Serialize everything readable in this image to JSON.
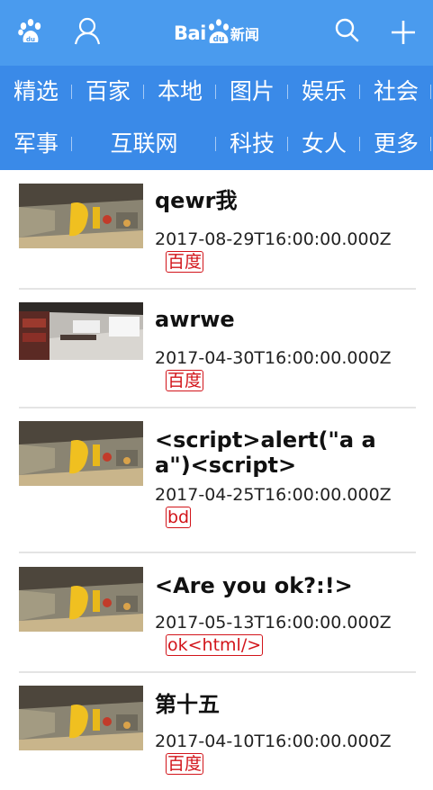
{
  "header": {
    "logo_text": "Bai",
    "logo_text_du": "du",
    "logo_suffix": "新闻",
    "icons": [
      "paw-icon",
      "user-icon",
      "search-icon",
      "plus-icon"
    ]
  },
  "nav": {
    "row1": [
      "精选",
      "百家",
      "本地",
      "图片",
      "娱乐",
      "社会"
    ],
    "row2": [
      "军事",
      "互联网",
      "科技",
      "女人",
      "更多"
    ]
  },
  "news": [
    {
      "title": "qewr我",
      "date": "2017-08-29T16:00:00.000Z",
      "source": "百度",
      "thumb": "office-yellow"
    },
    {
      "title": "awrwe",
      "date": "2017-04-30T16:00:00.000Z",
      "source": "百度",
      "thumb": "office-red"
    },
    {
      "title": "<script>alert(\"a a a\")<script>",
      "date": "2017-04-25T16:00:00.000Z",
      "source": "bd",
      "thumb": "office-yellow"
    },
    {
      "title": "<Are you ok?:!>",
      "date": "2017-05-13T16:00:00.000Z",
      "source": "ok<html/>",
      "thumb": "office-yellow"
    },
    {
      "title": "第十五",
      "date": "2017-04-10T16:00:00.000Z",
      "source": "百度",
      "thumb": "office-yellow"
    }
  ],
  "colors": {
    "header_bg": "#4a9bee",
    "nav_bg": "#3a8ae8",
    "tag_red": "#d2141a"
  }
}
